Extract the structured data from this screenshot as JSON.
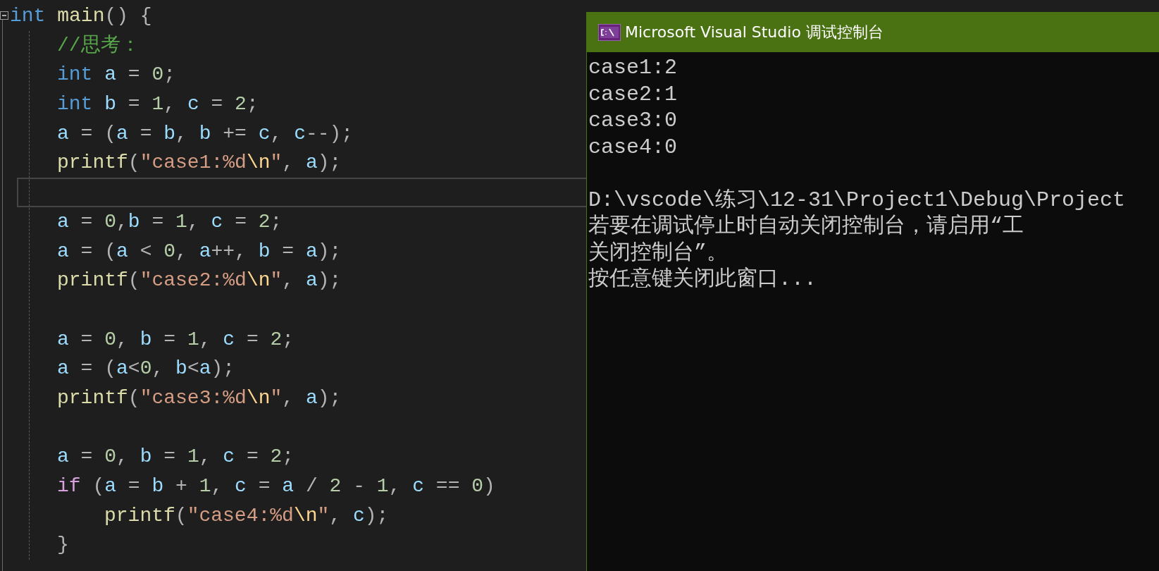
{
  "editor": {
    "lines": [
      {
        "kind": "code",
        "current": false,
        "collapsible": true,
        "tokens": [
          {
            "kind": "keyword",
            "text": "int "
          },
          {
            "kind": "function",
            "text": "main"
          },
          {
            "kind": "punct",
            "text": "() {"
          }
        ],
        "children": [
          {
            "kind": "code",
            "current": false,
            "tokens": [
              {
                "kind": "comment",
                "text": "//思考："
              }
            ]
          },
          {
            "kind": "code",
            "current": false,
            "tokens": [
              {
                "kind": "keyword",
                "text": "int "
              },
              {
                "kind": "variable",
                "text": "a"
              },
              {
                "kind": "punct",
                "text": " = "
              },
              {
                "kind": "number",
                "text": "0"
              },
              {
                "kind": "punct",
                "text": ";"
              }
            ]
          },
          {
            "kind": "code",
            "current": false,
            "tokens": [
              {
                "kind": "keyword",
                "text": "int "
              },
              {
                "kind": "variable",
                "text": "b"
              },
              {
                "kind": "punct",
                "text": " = "
              },
              {
                "kind": "number",
                "text": "1"
              },
              {
                "kind": "punct",
                "text": ", "
              },
              {
                "kind": "variable",
                "text": "c"
              },
              {
                "kind": "punct",
                "text": " = "
              },
              {
                "kind": "number",
                "text": "2"
              },
              {
                "kind": "punct",
                "text": ";"
              }
            ]
          },
          {
            "kind": "code",
            "current": false,
            "tokens": [
              {
                "kind": "variable",
                "text": "a"
              },
              {
                "kind": "punct",
                "text": " = ("
              },
              {
                "kind": "variable",
                "text": "a"
              },
              {
                "kind": "punct",
                "text": " = "
              },
              {
                "kind": "variable",
                "text": "b"
              },
              {
                "kind": "punct",
                "text": ", "
              },
              {
                "kind": "variable",
                "text": "b"
              },
              {
                "kind": "punct",
                "text": " += "
              },
              {
                "kind": "variable",
                "text": "c"
              },
              {
                "kind": "punct",
                "text": ", "
              },
              {
                "kind": "variable",
                "text": "c"
              },
              {
                "kind": "punct",
                "text": "--);"
              }
            ]
          },
          {
            "kind": "code",
            "current": false,
            "tokens": [
              {
                "kind": "function",
                "text": "printf"
              },
              {
                "kind": "punct",
                "text": "("
              },
              {
                "kind": "string",
                "text": "\"case1:%d"
              },
              {
                "kind": "escape",
                "text": "\\n"
              },
              {
                "kind": "string",
                "text": "\""
              },
              {
                "kind": "punct",
                "text": ", "
              },
              {
                "kind": "variable",
                "text": "a"
              },
              {
                "kind": "punct",
                "text": ");"
              }
            ]
          },
          {
            "kind": "blank",
            "current": true
          },
          {
            "kind": "code",
            "current": false,
            "tokens": [
              {
                "kind": "variable",
                "text": "a"
              },
              {
                "kind": "punct",
                "text": " = "
              },
              {
                "kind": "number",
                "text": "0"
              },
              {
                "kind": "punct",
                "text": ","
              },
              {
                "kind": "variable",
                "text": "b"
              },
              {
                "kind": "punct",
                "text": " = "
              },
              {
                "kind": "number",
                "text": "1"
              },
              {
                "kind": "punct",
                "text": ", "
              },
              {
                "kind": "variable",
                "text": "c"
              },
              {
                "kind": "punct",
                "text": " = "
              },
              {
                "kind": "number",
                "text": "2"
              },
              {
                "kind": "punct",
                "text": ";"
              }
            ]
          },
          {
            "kind": "code",
            "current": false,
            "tokens": [
              {
                "kind": "variable",
                "text": "a"
              },
              {
                "kind": "punct",
                "text": " = ("
              },
              {
                "kind": "variable",
                "text": "a"
              },
              {
                "kind": "punct",
                "text": " < "
              },
              {
                "kind": "number",
                "text": "0"
              },
              {
                "kind": "punct",
                "text": ", "
              },
              {
                "kind": "variable",
                "text": "a"
              },
              {
                "kind": "punct",
                "text": "++, "
              },
              {
                "kind": "variable",
                "text": "b"
              },
              {
                "kind": "punct",
                "text": " = "
              },
              {
                "kind": "variable",
                "text": "a"
              },
              {
                "kind": "punct",
                "text": ");"
              }
            ]
          },
          {
            "kind": "code",
            "current": false,
            "tokens": [
              {
                "kind": "function",
                "text": "printf"
              },
              {
                "kind": "punct",
                "text": "("
              },
              {
                "kind": "string",
                "text": "\"case2:%d"
              },
              {
                "kind": "escape",
                "text": "\\n"
              },
              {
                "kind": "string",
                "text": "\""
              },
              {
                "kind": "punct",
                "text": ", "
              },
              {
                "kind": "variable",
                "text": "a"
              },
              {
                "kind": "punct",
                "text": ");"
              }
            ]
          },
          {
            "kind": "blank",
            "current": false
          },
          {
            "kind": "code",
            "current": false,
            "tokens": [
              {
                "kind": "variable",
                "text": "a"
              },
              {
                "kind": "punct",
                "text": " = "
              },
              {
                "kind": "number",
                "text": "0"
              },
              {
                "kind": "punct",
                "text": ", "
              },
              {
                "kind": "variable",
                "text": "b"
              },
              {
                "kind": "punct",
                "text": " = "
              },
              {
                "kind": "number",
                "text": "1"
              },
              {
                "kind": "punct",
                "text": ", "
              },
              {
                "kind": "variable",
                "text": "c"
              },
              {
                "kind": "punct",
                "text": " = "
              },
              {
                "kind": "number",
                "text": "2"
              },
              {
                "kind": "punct",
                "text": ";"
              }
            ]
          },
          {
            "kind": "code",
            "current": false,
            "tokens": [
              {
                "kind": "variable",
                "text": "a"
              },
              {
                "kind": "punct",
                "text": " = ("
              },
              {
                "kind": "variable",
                "text": "a"
              },
              {
                "kind": "punct",
                "text": "<"
              },
              {
                "kind": "number",
                "text": "0"
              },
              {
                "kind": "punct",
                "text": ", "
              },
              {
                "kind": "variable",
                "text": "b"
              },
              {
                "kind": "punct",
                "text": "<"
              },
              {
                "kind": "variable",
                "text": "a"
              },
              {
                "kind": "punct",
                "text": ");"
              }
            ]
          },
          {
            "kind": "code",
            "current": false,
            "tokens": [
              {
                "kind": "function",
                "text": "printf"
              },
              {
                "kind": "punct",
                "text": "("
              },
              {
                "kind": "string",
                "text": "\"case3:%d"
              },
              {
                "kind": "escape",
                "text": "\\n"
              },
              {
                "kind": "string",
                "text": "\""
              },
              {
                "kind": "punct",
                "text": ", "
              },
              {
                "kind": "variable",
                "text": "a"
              },
              {
                "kind": "punct",
                "text": ");"
              }
            ]
          },
          {
            "kind": "blank",
            "current": false
          },
          {
            "kind": "code",
            "current": false,
            "tokens": [
              {
                "kind": "variable",
                "text": "a"
              },
              {
                "kind": "punct",
                "text": " = "
              },
              {
                "kind": "number",
                "text": "0"
              },
              {
                "kind": "punct",
                "text": ", "
              },
              {
                "kind": "variable",
                "text": "b"
              },
              {
                "kind": "punct",
                "text": " = "
              },
              {
                "kind": "number",
                "text": "1"
              },
              {
                "kind": "punct",
                "text": ", "
              },
              {
                "kind": "variable",
                "text": "c"
              },
              {
                "kind": "punct",
                "text": " = "
              },
              {
                "kind": "number",
                "text": "2"
              },
              {
                "kind": "punct",
                "text": ";"
              }
            ]
          },
          {
            "kind": "code",
            "current": false,
            "tokens": [
              {
                "kind": "control",
                "text": "if"
              },
              {
                "kind": "punct",
                "text": " ("
              },
              {
                "kind": "variable",
                "text": "a"
              },
              {
                "kind": "punct",
                "text": " = "
              },
              {
                "kind": "variable",
                "text": "b"
              },
              {
                "kind": "punct",
                "text": " + "
              },
              {
                "kind": "number",
                "text": "1"
              },
              {
                "kind": "punct",
                "text": ", "
              },
              {
                "kind": "variable",
                "text": "c"
              },
              {
                "kind": "punct",
                "text": " = "
              },
              {
                "kind": "variable",
                "text": "a"
              },
              {
                "kind": "punct",
                "text": " / "
              },
              {
                "kind": "number",
                "text": "2"
              },
              {
                "kind": "punct",
                "text": " - "
              },
              {
                "kind": "number",
                "text": "1"
              },
              {
                "kind": "punct",
                "text": ", "
              },
              {
                "kind": "variable",
                "text": "c"
              },
              {
                "kind": "punct",
                "text": " == "
              },
              {
                "kind": "number",
                "text": "0"
              },
              {
                "kind": "punct",
                "text": ")"
              }
            ],
            "children": [
              {
                "kind": "code",
                "current": false,
                "tokens": [
                  {
                    "kind": "function",
                    "text": "printf"
                  },
                  {
                    "kind": "punct",
                    "text": "("
                  },
                  {
                    "kind": "string",
                    "text": "\"case4:%d"
                  },
                  {
                    "kind": "escape",
                    "text": "\\n"
                  },
                  {
                    "kind": "string",
                    "text": "\""
                  },
                  {
                    "kind": "punct",
                    "text": ", "
                  },
                  {
                    "kind": "variable",
                    "text": "c"
                  },
                  {
                    "kind": "punct",
                    "text": ");"
                  }
                ]
              }
            ]
          },
          {
            "kind": "code",
            "current": false,
            "tokens": [
              {
                "kind": "punct",
                "text": "}"
              }
            ]
          }
        ]
      }
    ]
  },
  "console": {
    "title": "Microsoft Visual Studio 调试控制台",
    "output": [
      "case1:2",
      "case2:1",
      "case3:0",
      "case4:0"
    ],
    "messages": [
      "D:\\vscode\\练习\\12-31\\Project1\\Debug\\Project",
      "若要在调试停止时自动关闭控制台，请启用“工",
      "关闭控制台”。",
      "按任意键关闭此窗口..."
    ]
  }
}
